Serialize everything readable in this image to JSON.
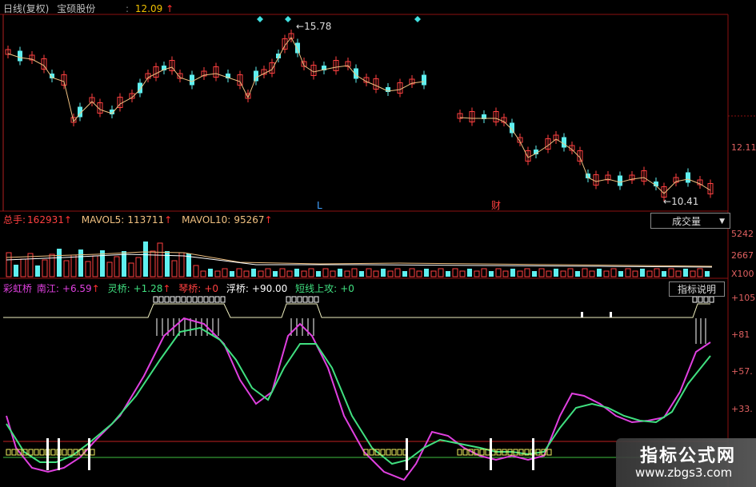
{
  "header": {
    "period": "日线(复权)",
    "stock_name": "宝硕股份",
    "price_prefix": ":",
    "price": "12.09",
    "price_arrow": "↑"
  },
  "price_chart": {
    "high_label": "15.78",
    "low_label": "10.41",
    "axis_label": "12.11",
    "marker_l": "L",
    "marker_cai": "财"
  },
  "volume_panel": {
    "total_label": "总手:",
    "total_value": "162931",
    "mavol5_label": "MAVOL5:",
    "mavol5_value": "113711",
    "mavol10_label": "MAVOL10:",
    "mavol10_value": "95267",
    "arrow": "↑",
    "dropdown": "成交量",
    "axis": [
      "5242",
      "2667",
      "X100"
    ]
  },
  "indicator_panel": {
    "name": "彩虹桥",
    "nanjiang_label": "南江:",
    "nanjiang_value": "+6.59",
    "lingqiao_label": "灵桥:",
    "lingqiao_value": "+1.28",
    "qinqiao_label": "琴桥:",
    "qinqiao_value": "+0",
    "fuqiao_label": "浮桥:",
    "fuqiao_value": "+90.00",
    "duanxian_label": "短线上攻:",
    "duanxian_value": "+0",
    "arrow": "↑",
    "button": "指标说明",
    "axis": [
      "+105",
      "+81",
      "+57.",
      "+33."
    ]
  },
  "watermark": {
    "cn": "指标公式网",
    "en": "www.zbgs3.com"
  },
  "colors": {
    "up": "#ff4040",
    "down": "#5ff0f0",
    "ma": "#f0c080",
    "magenta": "#e040e0",
    "green": "#40e080",
    "yellow": "#f0f060",
    "white": "#ffffff",
    "grid": "#8b1010"
  }
}
